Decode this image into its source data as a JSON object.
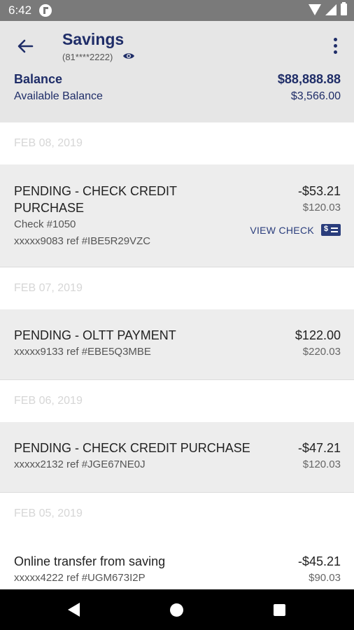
{
  "status_bar": {
    "time": "6:42",
    "icons": [
      "app-notification-icon",
      "wifi-icon",
      "signal-icon",
      "battery-icon"
    ]
  },
  "header": {
    "title": "Savings",
    "account_number": "(81****2222)",
    "balance_label": "Balance",
    "balance_value": "$88,888.88",
    "available_label": "Available Balance",
    "available_value": "$3,566.00"
  },
  "transactions": [
    {
      "date": "FEB 08, 2019",
      "description_lines": [
        "PENDING - CHECK CREDIT",
        "PURCHASE"
      ],
      "check_number": "Check #1050",
      "reference": "xxxxx9083 ref #IBE5R29VZC",
      "amount": "-$53.21",
      "running_balance": "$120.03",
      "action_label": "VIEW CHECK"
    },
    {
      "date": "FEB 07, 2019",
      "description": "PENDING - OLTT PAYMENT",
      "reference": "xxxxx9133 ref #EBE5Q3MBE",
      "amount": "$122.00",
      "running_balance": "$220.03"
    },
    {
      "date": "FEB 06, 2019",
      "description": "PENDING - CHECK CREDIT PURCHASE",
      "reference": "xxxxx2132 ref #JGE67NE0J",
      "amount": "-$47.21",
      "running_balance": "$120.03"
    },
    {
      "date": "FEB 05, 2019",
      "description": "Online transfer from saving",
      "reference": "xxxxx4222 ref #UGM673I2P",
      "amount": "-$45.21",
      "running_balance": "$90.03"
    }
  ],
  "colors": {
    "brand_navy": "#1f2d68",
    "header_bg": "#e6e6e6",
    "row_bg": "#ededed",
    "date_text": "#d6d6d6"
  }
}
